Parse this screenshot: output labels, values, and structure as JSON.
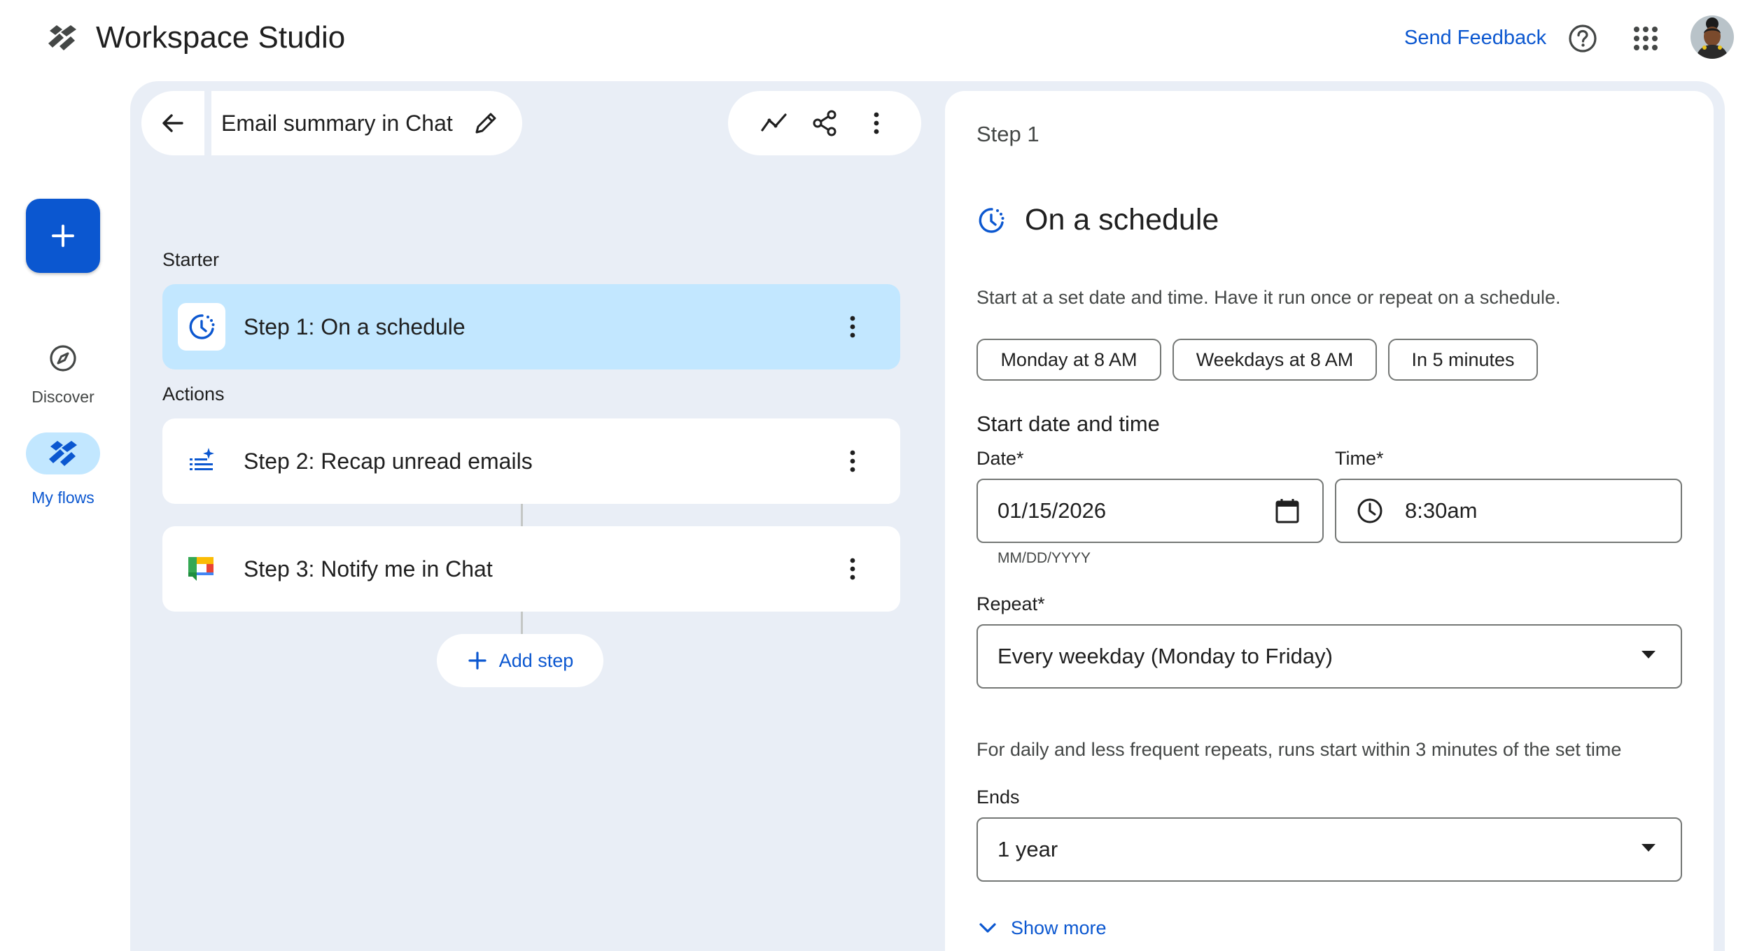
{
  "header": {
    "app_title": "Workspace Studio",
    "feedback_label": "Send Feedback"
  },
  "rail": {
    "create_icon": "plus-icon",
    "items": [
      {
        "label": "Discover",
        "icon": "compass-icon",
        "active": false
      },
      {
        "label": "My flows",
        "icon": "flows-icon",
        "active": true
      }
    ]
  },
  "flow": {
    "title": "Email summary in Chat",
    "starter_label": "Starter",
    "actions_label": "Actions",
    "steps": [
      {
        "prefix": "Step 1:",
        "name": "On a schedule",
        "icon": "schedule-icon",
        "selected": true
      },
      {
        "prefix": "Step 2:",
        "name": "Recap unread emails",
        "icon": "list-sparkle-icon",
        "selected": false
      },
      {
        "prefix": "Step 3:",
        "name": "Notify me in Chat",
        "icon": "google-chat-icon",
        "selected": false
      }
    ],
    "add_step_label": "Add step"
  },
  "panel": {
    "step_heading": "Step 1",
    "title": "On a schedule",
    "description": "Start at a set date and time. Have it run once or repeat on a schedule.",
    "chips": [
      "Monday at 8 AM",
      "Weekdays at 8 AM",
      "In 5 minutes"
    ],
    "start_heading": "Start date and time",
    "date": {
      "label": "Date*",
      "value": "01/15/2026",
      "hint": "MM/DD/YYYY"
    },
    "time": {
      "label": "Time*",
      "value": "8:30am"
    },
    "repeat": {
      "label": "Repeat*",
      "value": "Every weekday (Monday to Friday)"
    },
    "repeat_note": "For daily and less frequent repeats, runs start within 3 minutes of the set time",
    "ends": {
      "label": "Ends",
      "value": "1 year"
    },
    "show_more_label": "Show more"
  },
  "colors": {
    "accent": "#0b57d0",
    "selected_step": "#c2e7ff",
    "canvas": "#e9eef6"
  }
}
